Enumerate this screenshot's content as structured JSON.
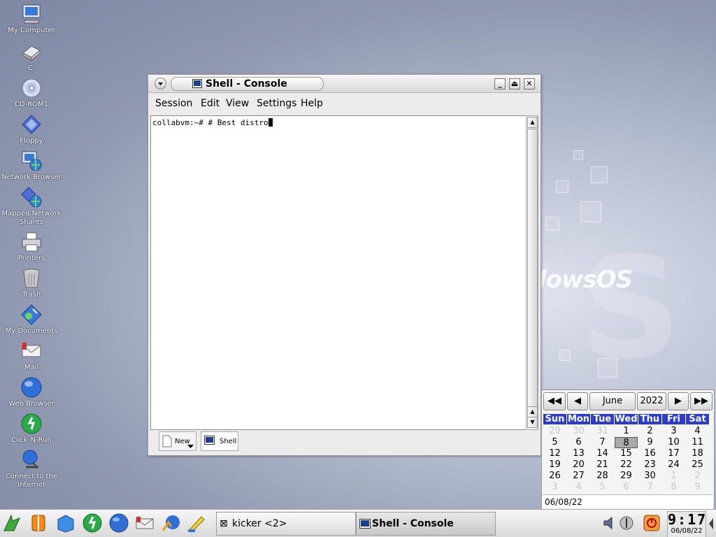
{
  "desktop": {
    "icons": [
      {
        "label": "My Computer",
        "icon": "computer-icon"
      },
      {
        "label": "C:",
        "icon": "drive-icon"
      },
      {
        "label": "CD-ROM1",
        "icon": "cdrom-icon"
      },
      {
        "label": "Floppy",
        "icon": "floppy-icon"
      },
      {
        "label": "Network Browser",
        "icon": "network-icon"
      },
      {
        "label": "Mapped Network Shares",
        "icon": "network-share-icon"
      },
      {
        "label": "Printers",
        "icon": "printer-icon"
      },
      {
        "label": "Trash",
        "icon": "trash-icon"
      },
      {
        "label": "My Documents",
        "icon": "documents-icon"
      },
      {
        "label": "Mail",
        "icon": "mail-icon"
      },
      {
        "label": "Web Browser",
        "icon": "globe-icon"
      },
      {
        "label": "Click-N-Run",
        "icon": "runner-icon"
      },
      {
        "label": "Connect to the Internet",
        "icon": "connect-icon"
      }
    ],
    "wallpaper_text": "lowsOS"
  },
  "window": {
    "title": "Shell - Console",
    "menu": [
      "Session",
      "Edit",
      "View",
      "Settings",
      "Help"
    ],
    "terminal_text": "collabvm:~# # Best distro",
    "tabs": {
      "new_label": "New",
      "shell_label": "Shell"
    }
  },
  "calendar": {
    "month": "June",
    "year": "2022",
    "weekdays": [
      "Sun",
      "Mon",
      "Tue",
      "Wed",
      "Thu",
      "Fri",
      "Sat"
    ],
    "weeks": [
      [
        "29",
        "30",
        "31",
        "1",
        "2",
        "3",
        "4"
      ],
      [
        "5",
        "6",
        "7",
        "8",
        "9",
        "10",
        "11"
      ],
      [
        "12",
        "13",
        "14",
        "15",
        "16",
        "17",
        "18"
      ],
      [
        "19",
        "20",
        "21",
        "22",
        "23",
        "24",
        "25"
      ],
      [
        "26",
        "27",
        "28",
        "29",
        "30",
        "1",
        "2"
      ],
      [
        "3",
        "4",
        "5",
        "6",
        "7",
        "8",
        "9"
      ]
    ],
    "selected": "8",
    "date_field": "06/08/22",
    "header_color": "#2c3ccd"
  },
  "taskbar": {
    "tasks": [
      "kicker <2>",
      "Shell - Console"
    ],
    "time": "9:17",
    "date": "06/08/22"
  }
}
